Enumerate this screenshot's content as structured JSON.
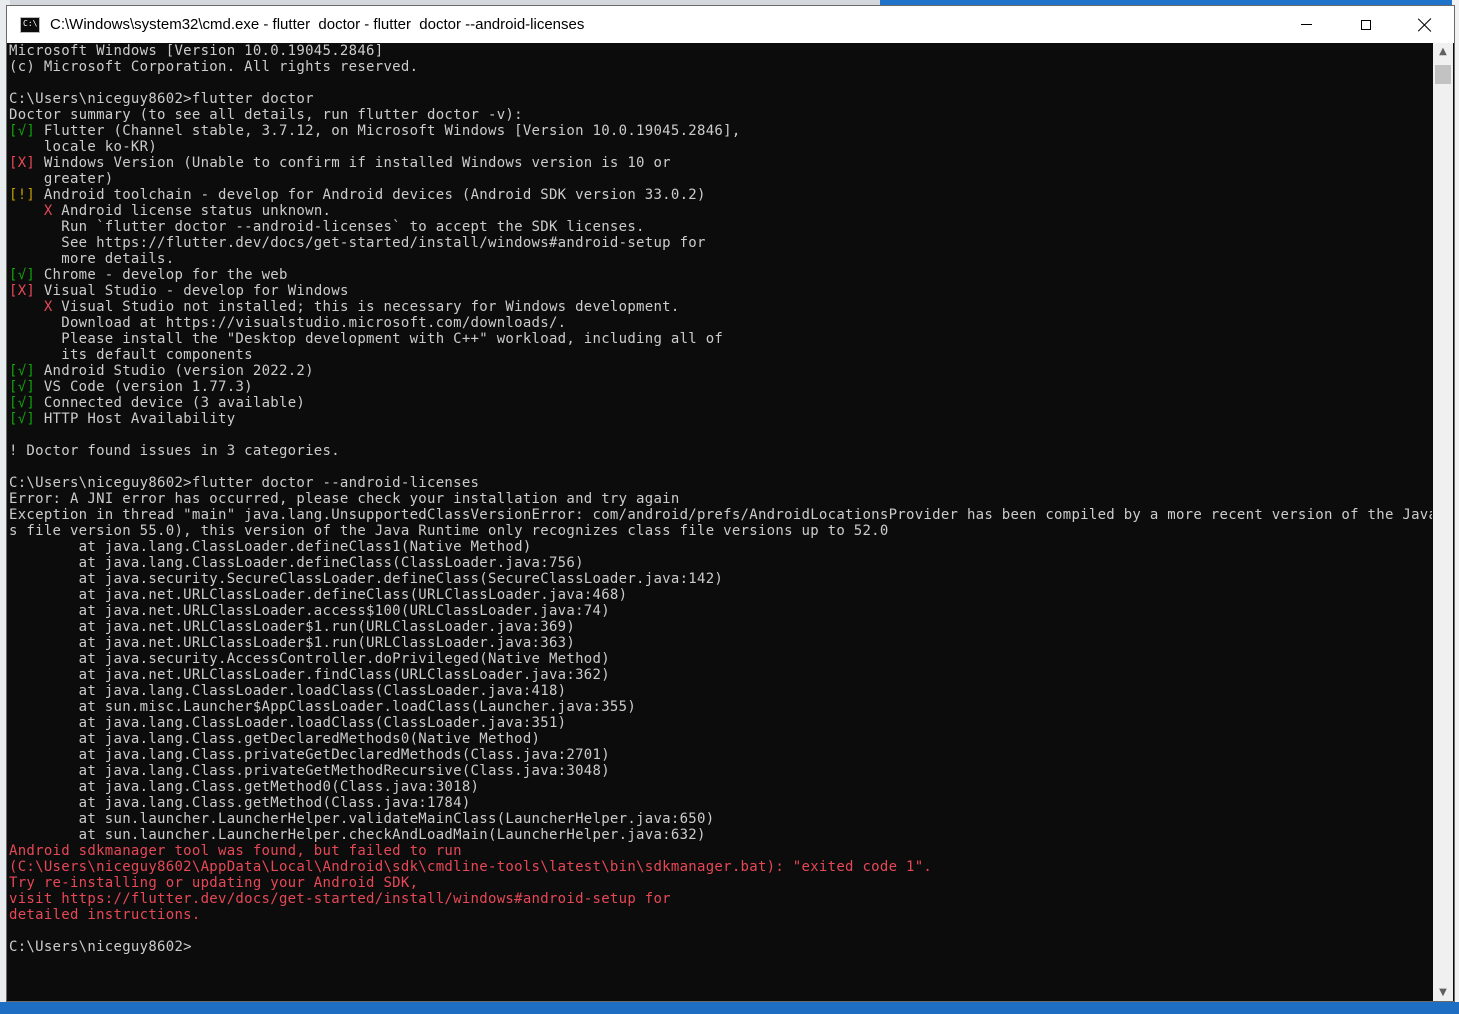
{
  "window": {
    "title": "C:\\Windows\\system32\\cmd.exe - flutter  doctor - flutter  doctor --android-licenses",
    "icon": "cmd-icon",
    "icon_label": "C:\\",
    "controls": [
      "minimize-icon",
      "maximize-icon",
      "close-icon"
    ]
  },
  "colors": {
    "background": "#0c0c0c",
    "text": "#cccccc",
    "ok": "#13a10e",
    "fail": "#e74856",
    "warn": "#c19c00",
    "error_text": "#e74856"
  },
  "scrollbar": {
    "up": "▲",
    "down": "▼"
  },
  "console": {
    "lines": [
      [
        "Microsoft Windows [Version 10.0.19045.2846]"
      ],
      [
        "(c) Microsoft Corporation. All rights reserved."
      ],
      [
        ""
      ],
      [
        "C:\\Users\\niceguy8602>flutter doctor"
      ],
      [
        "Doctor summary (to see all details, run flutter doctor -v):"
      ],
      [
        "[√]",
        " Flutter (Channel stable, 3.7.12, on Microsoft Windows [Version 10.0.19045.2846],"
      ],
      [
        "    locale ko-KR)"
      ],
      [
        "[X]",
        " Windows Version (Unable to confirm if installed Windows version is 10 or"
      ],
      [
        "    greater)"
      ],
      [
        "[!]",
        " Android toolchain - develop for Android devices (Android SDK version 33.0.2)"
      ],
      [
        "    ",
        "X",
        " Android license status unknown."
      ],
      [
        "      Run `flutter doctor --android-licenses` to accept the SDK licenses."
      ],
      [
        "      See https://flutter.dev/docs/get-started/install/windows#android-setup for"
      ],
      [
        "      more details."
      ],
      [
        "[√]",
        " Chrome - develop for the web"
      ],
      [
        "[X]",
        " Visual Studio - develop for Windows"
      ],
      [
        "    ",
        "X",
        " Visual Studio not installed; this is necessary for Windows development."
      ],
      [
        "      Download at https://visualstudio.microsoft.com/downloads/."
      ],
      [
        "      Please install the \"Desktop development with C++\" workload, including all of"
      ],
      [
        "      its default components"
      ],
      [
        "[√]",
        " Android Studio (version 2022.2)"
      ],
      [
        "[√]",
        " VS Code (version 1.77.3)"
      ],
      [
        "[√]",
        " Connected device (3 available)"
      ],
      [
        "[√]",
        " HTTP Host Availability"
      ],
      [
        ""
      ],
      [
        "! Doctor found issues in 3 categories."
      ],
      [
        ""
      ],
      [
        "C:\\Users\\niceguy8602>flutter doctor --android-licenses"
      ],
      [
        "Error: A JNI error has occurred, please check your installation and try again"
      ],
      [
        "Exception in thread \"main\" java.lang.UnsupportedClassVersionError: com/android/prefs/AndroidLocationsProvider has been compiled by a more recent version of the Java Runtime (clas"
      ],
      [
        "s file version 55.0), this version of the Java Runtime only recognizes class file versions up to 52.0"
      ],
      [
        "        at java.lang.ClassLoader.defineClass1(Native Method)"
      ],
      [
        "        at java.lang.ClassLoader.defineClass(ClassLoader.java:756)"
      ],
      [
        "        at java.security.SecureClassLoader.defineClass(SecureClassLoader.java:142)"
      ],
      [
        "        at java.net.URLClassLoader.defineClass(URLClassLoader.java:468)"
      ],
      [
        "        at java.net.URLClassLoader.access$100(URLClassLoader.java:74)"
      ],
      [
        "        at java.net.URLClassLoader$1.run(URLClassLoader.java:369)"
      ],
      [
        "        at java.net.URLClassLoader$1.run(URLClassLoader.java:363)"
      ],
      [
        "        at java.security.AccessController.doPrivileged(Native Method)"
      ],
      [
        "        at java.net.URLClassLoader.findClass(URLClassLoader.java:362)"
      ],
      [
        "        at java.lang.ClassLoader.loadClass(ClassLoader.java:418)"
      ],
      [
        "        at sun.misc.Launcher$AppClassLoader.loadClass(Launcher.java:355)"
      ],
      [
        "        at java.lang.ClassLoader.loadClass(ClassLoader.java:351)"
      ],
      [
        "        at java.lang.Class.getDeclaredMethods0(Native Method)"
      ],
      [
        "        at java.lang.Class.privateGetDeclaredMethods(Class.java:2701)"
      ],
      [
        "        at java.lang.Class.privateGetMethodRecursive(Class.java:3048)"
      ],
      [
        "        at java.lang.Class.getMethod0(Class.java:3018)"
      ],
      [
        "        at java.lang.Class.getMethod(Class.java:1784)"
      ],
      [
        "        at sun.launcher.LauncherHelper.validateMainClass(LauncherHelper.java:650)"
      ],
      [
        "        at sun.launcher.LauncherHelper.checkAndLoadMain(LauncherHelper.java:632)"
      ],
      [
        "Android sdkmanager tool was found, but failed to run"
      ],
      [
        "(C:\\Users\\niceguy8602\\AppData\\Local\\Android\\sdk\\cmdline-tools\\latest\\bin\\sdkmanager.bat): \"exited code 1\"."
      ],
      [
        "Try re-installing or updating your Android SDK,"
      ],
      [
        "visit https://flutter.dev/docs/get-started/install/windows#android-setup for"
      ],
      [
        "detailed instructions."
      ],
      [
        ""
      ],
      [
        "C:\\Users\\niceguy8602>"
      ]
    ],
    "styles": [
      [
        ""
      ],
      [
        ""
      ],
      [
        ""
      ],
      [
        ""
      ],
      [
        ""
      ],
      [
        "g",
        ""
      ],
      [
        ""
      ],
      [
        "r",
        ""
      ],
      [
        ""
      ],
      [
        "y",
        ""
      ],
      [
        "",
        "r",
        ""
      ],
      [
        ""
      ],
      [
        ""
      ],
      [
        ""
      ],
      [
        "g",
        ""
      ],
      [
        "r",
        ""
      ],
      [
        "",
        "r",
        ""
      ],
      [
        ""
      ],
      [
        ""
      ],
      [
        ""
      ],
      [
        "g",
        ""
      ],
      [
        "g",
        ""
      ],
      [
        "g",
        ""
      ],
      [
        "g",
        ""
      ],
      [
        ""
      ],
      [
        ""
      ],
      [
        ""
      ],
      [
        ""
      ],
      [
        ""
      ],
      [
        ""
      ],
      [
        ""
      ],
      [
        ""
      ],
      [
        ""
      ],
      [
        ""
      ],
      [
        ""
      ],
      [
        ""
      ],
      [
        ""
      ],
      [
        ""
      ],
      [
        ""
      ],
      [
        ""
      ],
      [
        ""
      ],
      [
        ""
      ],
      [
        ""
      ],
      [
        ""
      ],
      [
        ""
      ],
      [
        ""
      ],
      [
        ""
      ],
      [
        ""
      ],
      [
        ""
      ],
      [
        ""
      ],
      [
        "err"
      ],
      [
        "err"
      ],
      [
        "err"
      ],
      [
        "err"
      ],
      [
        "err"
      ],
      [
        ""
      ],
      [
        ""
      ]
    ]
  }
}
